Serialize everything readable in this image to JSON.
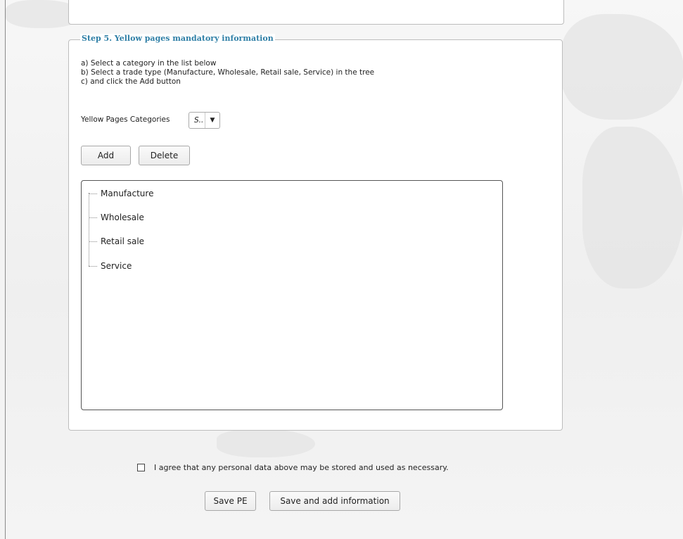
{
  "step5": {
    "legend": "Step 5. Yellow pages mandatory information",
    "instructions": [
      "a) Select a category in the list below",
      "b) Select a trade type (Manufacture, Wholesale, Retail sale, Service) in the tree",
      "c) and click the Add button"
    ],
    "categories_label": "Yellow Pages Categories",
    "categories_select": {
      "value": "S..",
      "arrow_icon": "triangle-down-icon"
    },
    "add_button": "Add",
    "delete_button": "Delete",
    "trade_types": [
      "Manufacture",
      "Wholesale",
      "Retail sale",
      "Service"
    ]
  },
  "agreement": {
    "checked": false,
    "label": "I agree that any personal data above may be stored and used as necessary."
  },
  "actions": {
    "save_pe": "Save PE",
    "save_and_add": "Save and add information"
  },
  "colors": {
    "legend": "#2f7fa6",
    "panel_border": "#bdbdbd",
    "background": "#f3f3f3"
  }
}
